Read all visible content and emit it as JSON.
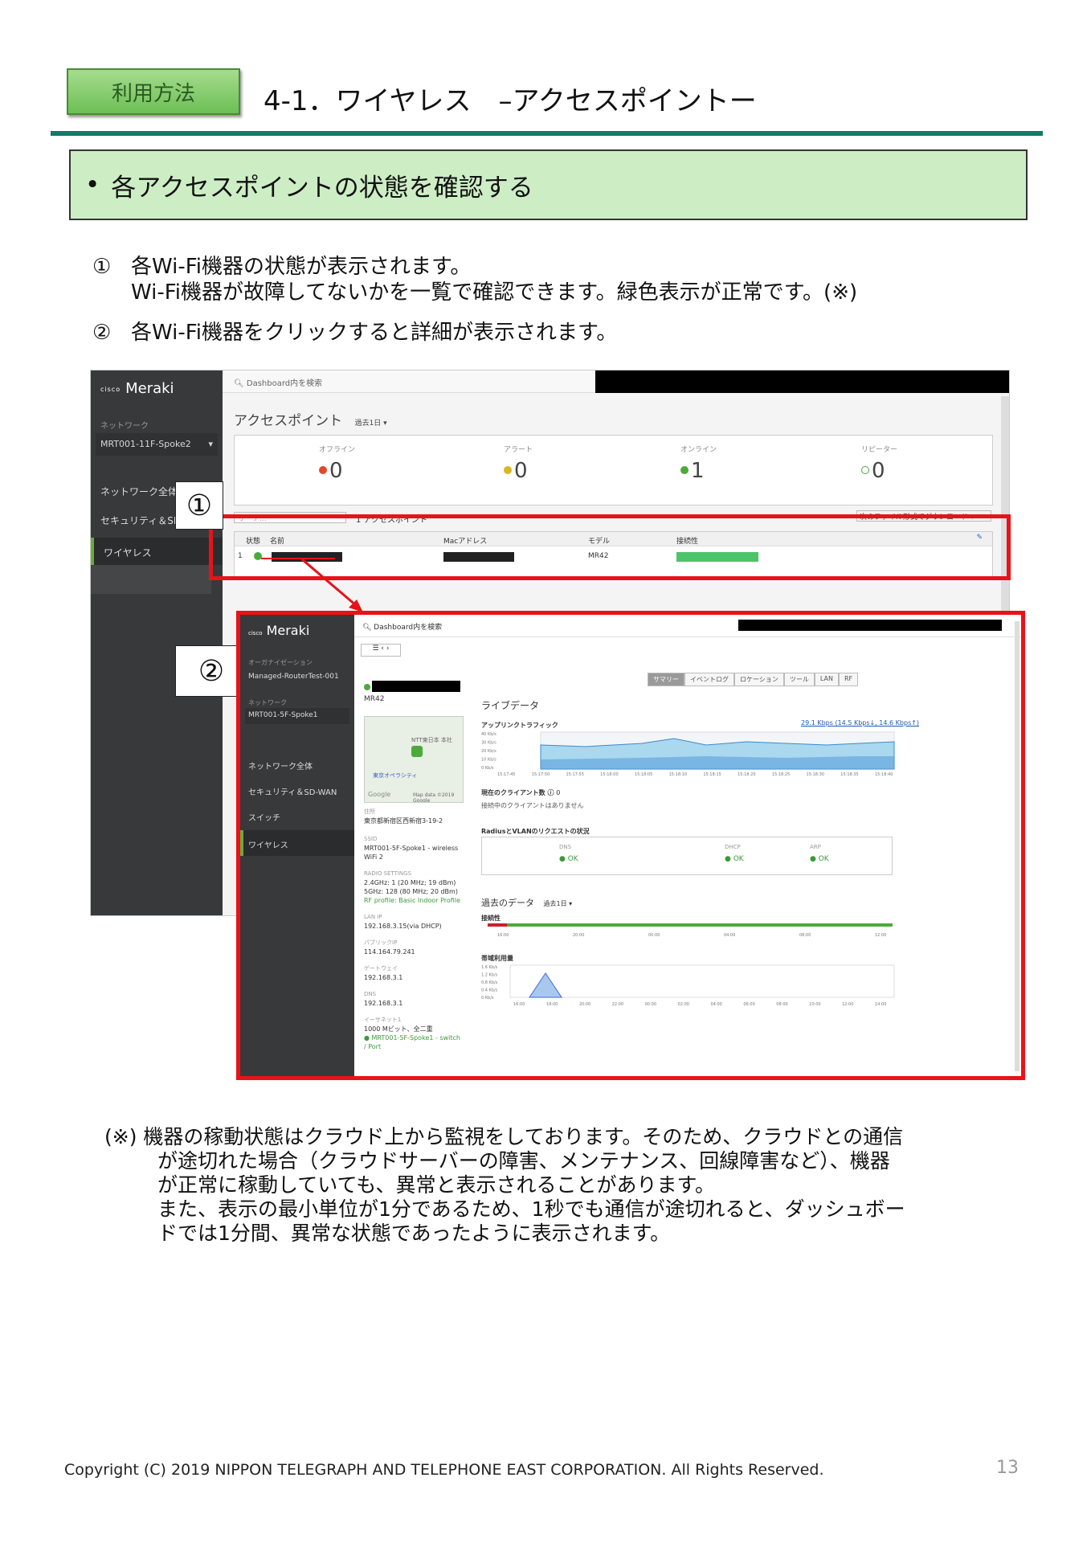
{
  "header": {
    "tag": "利用方法",
    "title": "4-1．ワイヤレス　–アクセスポイントー"
  },
  "summary_box": {
    "bullet": "•",
    "text": "各アクセスポイントの状態を確認する"
  },
  "steps": [
    {
      "num": "①",
      "line1": "各Wi-Fi機器の状態が表示されます。",
      "line2": "Wi-Fi機器が故障してないかを一覧で確認できます。緑色表示が正常です。(※)"
    },
    {
      "num": "②",
      "line1": "各Wi-Fi機器をクリックすると詳細が表示されます。",
      "line2": ""
    }
  ],
  "callouts": {
    "one": "①",
    "two": "②"
  },
  "dash1": {
    "brand_small": "cisco",
    "brand": "Meraki",
    "network_label": "ネットワーク",
    "network_name": "MRT001-11F-Spoke2",
    "menu": [
      "ネットワーク全体",
      "セキュリティ＆SD-WAN",
      "ワイヤレス"
    ],
    "search": "Dashboard内を検索",
    "page_title": "アクセスポイント",
    "period": "過去1日 ▾",
    "counts": [
      {
        "label": "オフライン",
        "value": "0",
        "color": "#e0492a"
      },
      {
        "label": "アラート",
        "value": "0",
        "color": "#d8b820"
      },
      {
        "label": "オンライン",
        "value": "1",
        "color": "#4caa3a"
      },
      {
        "label": "リピーター",
        "value": "0",
        "color": "#ffffff"
      }
    ],
    "search_box": "サーチ...",
    "count_text": "1 アクセスポイント",
    "download": "次のファイル形式でダウンロード ▾",
    "columns": [
      "状態",
      "名前",
      "Macアドレス",
      "モデル",
      "接続性"
    ],
    "row": {
      "index": "1",
      "model": "MR42"
    }
  },
  "dash2": {
    "brand_small": "cisco",
    "brand": "Meraki",
    "org_label": "オーガナイゼーション",
    "org_name": "Managed-RouterTest-001",
    "network_label": "ネットワーク",
    "network_name": "MRT001-5F-Spoke1",
    "menu": [
      "ネットワーク全体",
      "セキュリティ＆SD-WAN",
      "スイッチ",
      "ワイヤレス"
    ],
    "search": "Dashboard内を検索",
    "tabs": [
      "サマリー",
      "イベントログ",
      "ロケーション",
      "ツール",
      "LAN",
      "RF"
    ],
    "model": "MR42",
    "map_labels": [
      "NTT東日本 本社",
      "東京オペラシティ",
      "Google",
      "Map data ©2019 Google"
    ],
    "details": [
      {
        "label": "住所",
        "value": "東京都新宿区西新宿3-19-2"
      },
      {
        "label": "SSID",
        "value": "MRT001-5F-Spoke1 - wireless WiFi 2"
      },
      {
        "label": "RADIO SETTINGS",
        "value": "2.4GHz: 1 (20 MHz; 19 dBm)"
      },
      {
        "label": "",
        "value": "5GHz: 128 (80 MHz; 20 dBm)"
      },
      {
        "label": "",
        "value": "RF profile: Basic Indoor Profile"
      },
      {
        "label": "LAN IP",
        "value": "192.168.3.15(via DHCP)"
      },
      {
        "label": "パブリックIP",
        "value": "114.164.79.241"
      },
      {
        "label": "ゲートウェイ",
        "value": "192.168.3.1"
      },
      {
        "label": "DNS",
        "value": "192.168.3.1"
      },
      {
        "label": "イーサネット1",
        "value": "1000 Mビット、全二重"
      },
      {
        "label": "",
        "value": "● MRT001-5F-Spoke1 - switch / Port"
      }
    ],
    "live_title": "ライブデータ",
    "uplink_title": "アップリンクトラフィック",
    "uplink_legend": "29.1 Kbps (14.5 Kbps↓, 14.6 Kbps↑)",
    "uplink_y": [
      "40 Kb/s",
      "30 Kb/s",
      "20 Kb/s",
      "10 Kb/s",
      "0 Kb/s"
    ],
    "uplink_x": [
      "15:17:45",
      "15:17:50",
      "15:17:55",
      "15:18:00",
      "15:18:05",
      "15:18:10",
      "15:18:15",
      "15:18:20",
      "15:18:25",
      "15:18:30",
      "15:18:35",
      "15:18:40"
    ],
    "clients_title": "現在のクライアント数",
    "clients_value": "0",
    "clients_note": "接続中のクライアントはありません",
    "radius_title": "RadiusとVLANのリクエストの状況",
    "radius": [
      {
        "label": "DNS",
        "value": "● OK"
      },
      {
        "label": "DHCP",
        "value": "● OK"
      },
      {
        "label": "ARP",
        "value": "● OK"
      }
    ],
    "history_title": "過去のデータ",
    "history_period": "過去1日 ▾",
    "conn_title": "接続性",
    "conn_x": [
      "16:00",
      "20:00",
      "00:00",
      "04:00",
      "08:00",
      "12:00"
    ],
    "bw_title": "帯域利用量",
    "bw_y": [
      "1.6 Kb/s",
      "1.2 Kb/s",
      "0.8 Kb/s",
      "0.4 Kb/s",
      "0 Kb/s"
    ],
    "bw_x": [
      "16:00",
      "18:00",
      "20:00",
      "22:00",
      "00:00",
      "02:00",
      "04:00",
      "06:00",
      "08:00",
      "10:00",
      "12:00",
      "14:00"
    ]
  },
  "note": {
    "lines": [
      "(※) 機器の稼動状態はクラウド上から監視をしております。そのため、クラウドとの通信",
      "が途切れた場合（クラウドサーバーの障害、メンテナンス、回線障害など）、機器",
      "が正常に稼動していても、異常と表示されることがあります。",
      "また、表示の最小単位が1分であるため、1秒でも通信が途切れると、ダッシュボー",
      "ドでは1分間、異常な状態であったように表示されます。"
    ]
  },
  "footer": {
    "copyright": "Copyright (C) 2019 NIPPON TELEGRAPH AND TELEPHONE EAST CORPORATION. All Rights Reserved.",
    "page": "13"
  }
}
